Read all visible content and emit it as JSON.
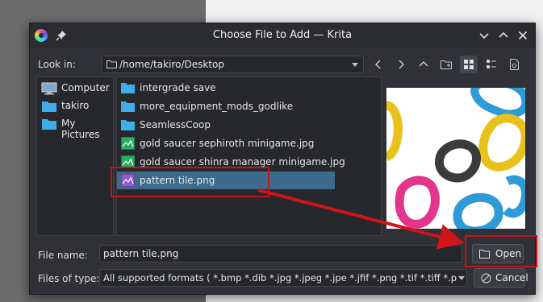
{
  "window": {
    "title": "Choose File to Add — Krita"
  },
  "look_in": {
    "label": "Look in:",
    "path": "/home/takiro/Desktop"
  },
  "places": [
    {
      "label": "Computer",
      "icon": "computer-icon"
    },
    {
      "label": "takiro",
      "icon": "folder-icon"
    },
    {
      "label": "My Pictures",
      "icon": "folder-icon"
    }
  ],
  "files": [
    {
      "name": "intergrade save",
      "type": "folder"
    },
    {
      "name": "more_equipment_mods_godlike",
      "type": "folder"
    },
    {
      "name": "SeamlessCoop",
      "type": "folder"
    },
    {
      "name": "gold saucer sephiroth minigame.jpg",
      "type": "image"
    },
    {
      "name": "gold saucer shinra manager minigame.jpg",
      "type": "image"
    },
    {
      "name": "pattern tile.png",
      "type": "image",
      "selected": true
    }
  ],
  "file_name": {
    "label": "File name:",
    "value": "pattern tile.png"
  },
  "files_of_type": {
    "label": "Files of type:",
    "value": "All supported formats ( *.bmp *.dib *.jpg *.jpeg *.jpe *.jfif *.png *.tif *.tiff *.p"
  },
  "buttons": {
    "open": "Open",
    "cancel": "Cancel"
  },
  "colors": {
    "selection": "#3d6b8c",
    "annotation": "#c4151c",
    "folder": "#3daee9"
  }
}
